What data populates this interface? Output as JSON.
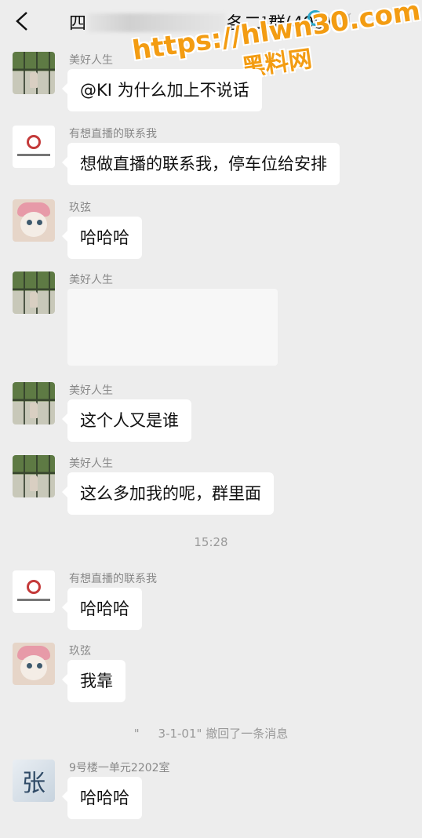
{
  "header": {
    "title_prefix": "四",
    "title_suffix": "各二¹群(499)"
  },
  "watermark": {
    "line1": "https://hlwn30.com",
    "line2": "黑料网"
  },
  "messages": [
    {
      "sender": "美好人生",
      "text": "@KI  为什么加上不说话"
    },
    {
      "sender": "有想直播的联系我",
      "text": "想做直播的联系我，停车位给安排"
    },
    {
      "sender": "玖弦",
      "text": "哈哈哈"
    },
    {
      "sender": "美好人生",
      "text": ""
    },
    {
      "sender": "美好人生",
      "text": "这个人又是谁"
    },
    {
      "sender": "美好人生",
      "text": "这么多加我的呢，群里面"
    },
    {
      "sender": "有想直播的联系我",
      "text": "哈哈哈"
    },
    {
      "sender": "玖弦",
      "text": "我靠"
    },
    {
      "sender": "9号楼一单元2202室",
      "text": "哈哈哈",
      "avatar_text": "张"
    }
  ],
  "timestamp": "15:28",
  "recall_notice": "\"     3-1-01\" 撤回了一条消息"
}
